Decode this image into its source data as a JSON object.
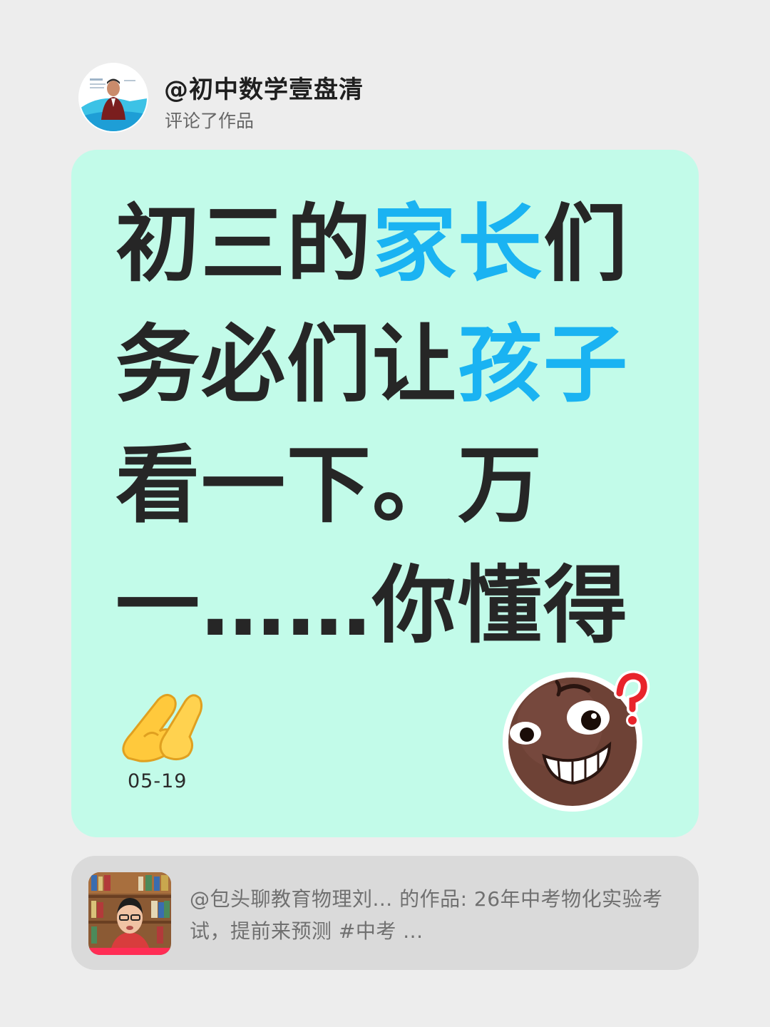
{
  "header": {
    "username": "@初中数学壹盘清",
    "action": "评论了作品"
  },
  "comment": {
    "segments": [
      {
        "text": "初三的",
        "highlight": false
      },
      {
        "text": "家长",
        "highlight": true
      },
      {
        "text": "们务必们让",
        "highlight": false
      },
      {
        "text": "孩子",
        "highlight": true
      },
      {
        "text": "看一下。万一……你懂得",
        "highlight": false
      }
    ],
    "date": "05-19"
  },
  "work": {
    "text": "@包头聊教育物理刘... 的作品: 26年中考物化实验考试，提前来预测 #中考 ..."
  },
  "icons": {
    "avatar": "teacher-avatar",
    "pray": "folded-hands-icon",
    "sticker": "confused-face-sticker-icon",
    "thumbnail": "video-thumbnail"
  },
  "colors": {
    "page_background": "#ededed",
    "comment_card": "#c2fbe9",
    "highlight": "#1ab3f2",
    "work_card": "#dadada"
  }
}
